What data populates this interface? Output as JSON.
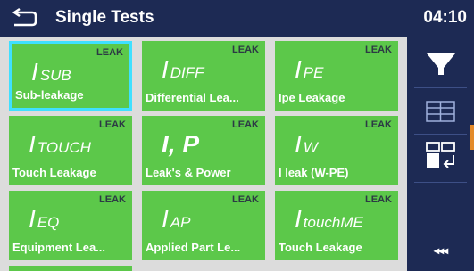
{
  "header": {
    "title": "Single Tests",
    "time": "04:10"
  },
  "tiles": [
    {
      "category": "LEAK",
      "symbol_main": "I",
      "symbol_sub": "SUB",
      "name": "Sub-leakage",
      "selected": true
    },
    {
      "category": "LEAK",
      "symbol_main": "I",
      "symbol_sub": "DIFF",
      "name": "Differential Lea..."
    },
    {
      "category": "LEAK",
      "symbol_main": "I",
      "symbol_sub": "PE",
      "name": "Ipe Leakage"
    },
    {
      "category": "LEAK",
      "symbol_main": "I",
      "symbol_sub": "TOUCH",
      "name": "Touch Leakage"
    },
    {
      "category": "LEAK",
      "symbol_main": "I, P",
      "symbol_sub": "",
      "name": "Leak's & Power"
    },
    {
      "category": "LEAK",
      "symbol_main": "I",
      "symbol_sub": "W",
      "name": "I leak (W-PE)"
    },
    {
      "category": "LEAK",
      "symbol_main": "I",
      "symbol_sub": "EQ",
      "name": "Equipment Lea..."
    },
    {
      "category": "LEAK",
      "symbol_main": "I",
      "symbol_sub": "AP",
      "name": "Applied Part Le..."
    },
    {
      "category": "LEAK",
      "symbol_main": "I",
      "symbol_sub": "touchME",
      "name": "Touch Leakage"
    }
  ],
  "sidebar": {
    "more_label": "◂◂◂"
  },
  "colors": {
    "header_bg": "#1d2a54",
    "tile_green": "#5cc84a",
    "selected_border": "#3fe0ff",
    "accent_orange": "#e38a2a"
  }
}
